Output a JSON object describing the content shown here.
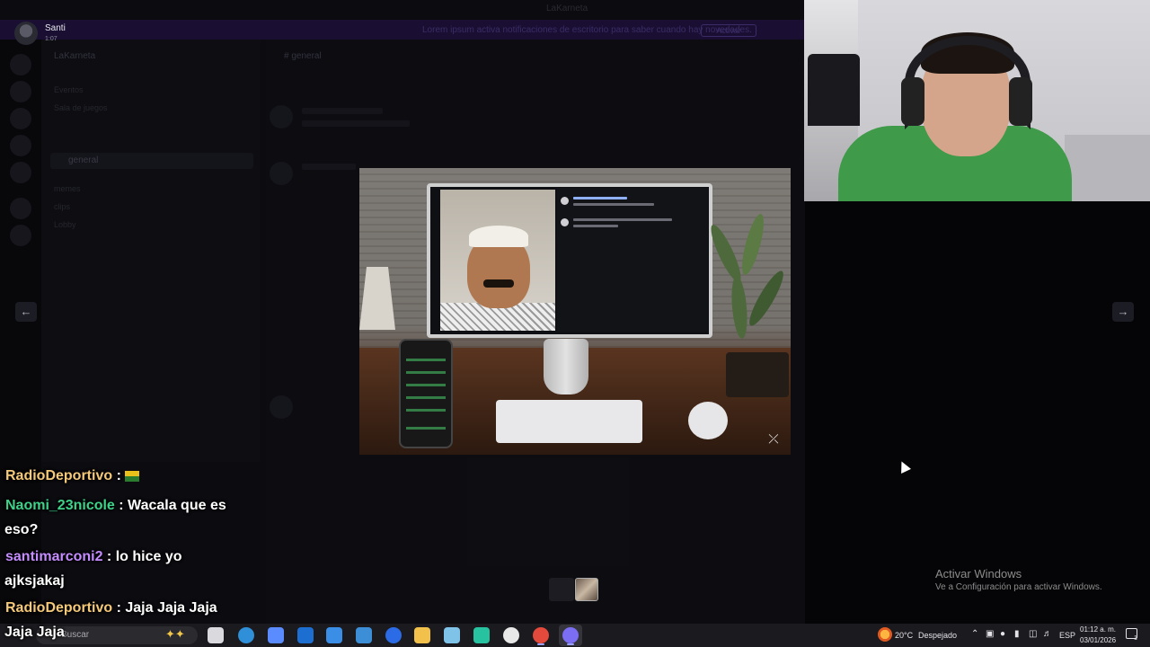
{
  "window": {
    "app_title": "LaKarneta",
    "banner_text": "Lorem ipsum activa notificaciones de escritorio para saber cuando hay novedades.",
    "banner_button": "Activar"
  },
  "discord_bg": {
    "server_name": "LaKarneta",
    "channels": [
      "Eventos",
      "Sala de juegos",
      "general",
      "memes",
      "clips",
      "Lobby"
    ],
    "active_channel": "general",
    "chat_header": "# general"
  },
  "viewer": {
    "user_name": "Santi",
    "timestamp": "1:07",
    "prev_icon": "arrow-left-icon",
    "next_icon": "arrow-right-icon"
  },
  "media": {
    "watermark_icon": "capcut-icon"
  },
  "overlay_chat": {
    "messages": [
      {
        "user": "RadioDeportivo",
        "sep": " :",
        "text": "",
        "color": "#f5c97a",
        "emote": "flag-emote"
      },
      {
        "user": "Naomi_23nicole",
        "sep": " :",
        "text": " Wacala que es",
        "cont": "eso?",
        "color": "#3ed18a"
      },
      {
        "user": "santimarconi2",
        "sep": " :",
        "text": " lo hice yo",
        "cont": "ajksjakaj",
        "color": "#c58cff"
      },
      {
        "user": "RadioDeportivo",
        "sep": " :",
        "text": " Jaja Jaja Jaja",
        "cont": "Jaja Jaja",
        "color": "#f5c97a"
      }
    ]
  },
  "activation": {
    "title": "Activar Windows",
    "subtitle": "Ve a Configuración para activar Windows."
  },
  "taskbar": {
    "search_placeholder": "Buscar",
    "weather_temp": "20°C",
    "weather_desc": "Despejado",
    "language": "ESP",
    "time": "01:12 a. m.",
    "date": "03/01/2026",
    "notif_count": "1",
    "apps": [
      {
        "name": "task-view-icon",
        "color": "#d9d9de"
      },
      {
        "name": "edge-icon",
        "color": "#2f8fd8"
      },
      {
        "name": "copilot-icon",
        "color": "#5a8cff"
      },
      {
        "name": "outlook-icon",
        "color": "#1c6fd1"
      },
      {
        "name": "store-icon",
        "color": "#3a8ee6"
      },
      {
        "name": "vscode-icon",
        "color": "#3c8fd6"
      },
      {
        "name": "ubisoft-icon",
        "color": "#2b6be6"
      },
      {
        "name": "file-explorer-icon",
        "color": "#f2c14b"
      },
      {
        "name": "notepad-icon",
        "color": "#7fc4e8"
      },
      {
        "name": "pycharm-icon",
        "color": "#27c2a0"
      },
      {
        "name": "obs-icon",
        "color": "#e8e8e8"
      },
      {
        "name": "chrome-icon",
        "color": "#e34a3b"
      },
      {
        "name": "discord-chrome-icon",
        "color": "#7b6ef2"
      }
    ]
  }
}
